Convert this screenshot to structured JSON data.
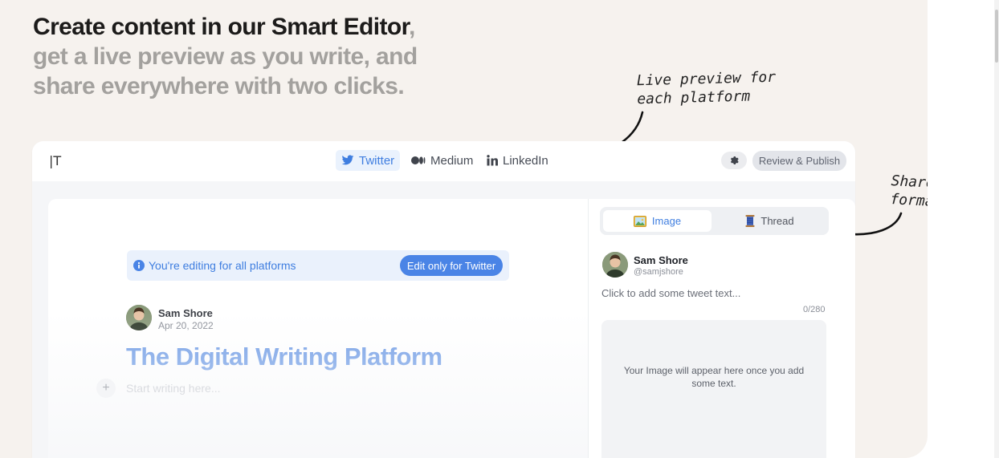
{
  "hero": {
    "line1": "Create content in our Smart Editor",
    "comma": ",",
    "line2": "get a live preview as you write, and",
    "line3": "share everywhere with two clicks."
  },
  "annotations": {
    "live_preview": [
      "Live preview for",
      "each platform"
    ],
    "share_native": [
      "Share in nativ",
      "formats"
    ]
  },
  "editor": {
    "logo": "|T",
    "platform_tabs": [
      {
        "label": "Twitter",
        "icon": "twitter-icon",
        "active": true
      },
      {
        "label": "Medium",
        "icon": "medium-icon",
        "active": false
      },
      {
        "label": "LinkedIn",
        "icon": "linkedin-icon",
        "active": false
      }
    ],
    "settings_icon": "gear-icon",
    "review_label": "Review & Publish",
    "banner_text": "You're editing for all platforms",
    "banner_button": "Edit only for Twitter",
    "author_name": "Sam Shore",
    "author_date": "Apr 20, 2022",
    "title": "The Digital Writing Platform",
    "placeholder": "Start writing here...",
    "add_symbol": "+"
  },
  "preview": {
    "tabs": [
      {
        "label": "Image",
        "icon": "image-icon",
        "active": true
      },
      {
        "label": "Thread",
        "icon": "spool-icon",
        "active": false
      }
    ],
    "name": "Sam Shore",
    "handle": "@samjshore",
    "tweet_placeholder": "Click to add some tweet text...",
    "char_count": "0/280",
    "image_message": "Your Image will appear here once you add some text."
  },
  "colors": {
    "accent": "#4a84e6",
    "panel_bg": "#f6f2ee",
    "headline_dark": "#1c1b1a",
    "headline_muted": "#a3a19e"
  }
}
